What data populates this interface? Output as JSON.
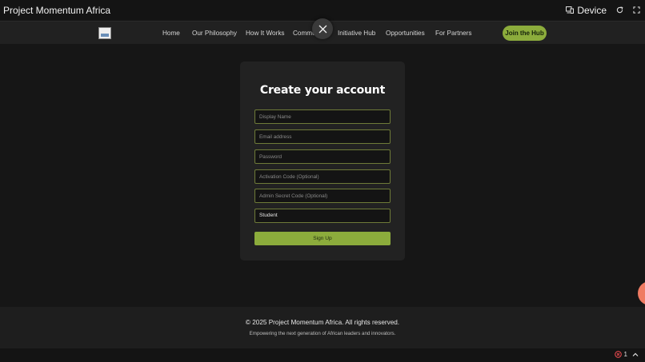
{
  "app_bar": {
    "title": "Project Momentum Africa",
    "device_label": "Device"
  },
  "nav": {
    "links": [
      {
        "label": "Home"
      },
      {
        "label": "Our Philosophy"
      },
      {
        "label": "How It Works"
      },
      {
        "label": "Commu"
      },
      {
        "label": "Initiative Hub"
      },
      {
        "label": "Opportunities"
      },
      {
        "label": "For Partners"
      }
    ],
    "cta_label": "Join the Hub"
  },
  "signup": {
    "title": "Create your account",
    "fields": {
      "display_name": {
        "placeholder": "Display Name"
      },
      "email": {
        "placeholder": "Email address"
      },
      "password": {
        "placeholder": "Password"
      },
      "activation_code": {
        "placeholder": "Activation Code (Optional)"
      },
      "admin_code": {
        "placeholder": "Admin Secret Code (Optional)"
      }
    },
    "role_select": {
      "value": "Student"
    },
    "submit_label": "Sign Up"
  },
  "footer": {
    "copyright": "© 2025 Project Momentum Africa. All rights reserved.",
    "tagline": "Empowering the next generation of African leaders and innovators."
  },
  "status_bar": {
    "error_count": "1"
  },
  "colors": {
    "accent": "#8cac3c",
    "background": "#161616",
    "card": "#222222",
    "field_border": "#6e7a38",
    "floating_circle": "#ef7b62",
    "error": "#e5484d"
  }
}
